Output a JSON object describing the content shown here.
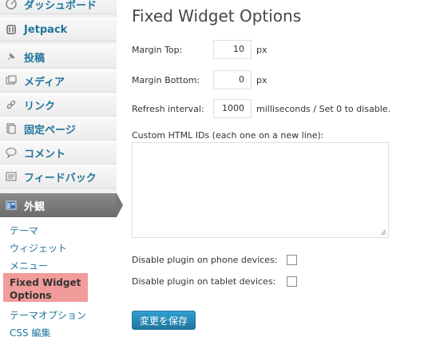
{
  "sidebar": {
    "items": [
      {
        "label": "ダッシュボード",
        "icon": "dashboard-icon"
      },
      {
        "label": "Jetpack",
        "icon": "jetpack-icon"
      },
      {
        "label": "投稿",
        "icon": "pin-icon"
      },
      {
        "label": "メディア",
        "icon": "media-icon"
      },
      {
        "label": "リンク",
        "icon": "link-icon"
      },
      {
        "label": "固定ページ",
        "icon": "pages-icon"
      },
      {
        "label": "コメント",
        "icon": "comment-icon"
      },
      {
        "label": "フィードバック",
        "icon": "feedback-icon"
      }
    ],
    "active": {
      "label": "外観",
      "icon": "appearance-icon"
    },
    "submenu": [
      {
        "label": "テーマ"
      },
      {
        "label": "ウィジェット"
      },
      {
        "label": "メニュー"
      },
      {
        "label": "Fixed Widget Options",
        "current": true
      },
      {
        "label": "テーマオプション"
      },
      {
        "label": "CSS 編集"
      }
    ]
  },
  "main": {
    "title": "Fixed Widget Options",
    "margin_top": {
      "label": "Margin Top:",
      "value": "10",
      "unit": "px"
    },
    "margin_bottom": {
      "label": "Margin Bottom:",
      "value": "0",
      "unit": "px"
    },
    "refresh_interval": {
      "label": "Refresh interval:",
      "value": "1000",
      "unit": "milliseconds / Set 0 to disable."
    },
    "custom_ids": {
      "label": "Custom HTML IDs (each one on a new line):",
      "value": ""
    },
    "disable_phone": {
      "label": "Disable plugin on phone devices:",
      "checked": false
    },
    "disable_tablet": {
      "label": "Disable plugin on tablet devices:",
      "checked": false
    },
    "save_label": "変更を保存"
  },
  "colors": {
    "link": "#21759b",
    "highlight": "#f29b9b",
    "button": "#21759b"
  }
}
